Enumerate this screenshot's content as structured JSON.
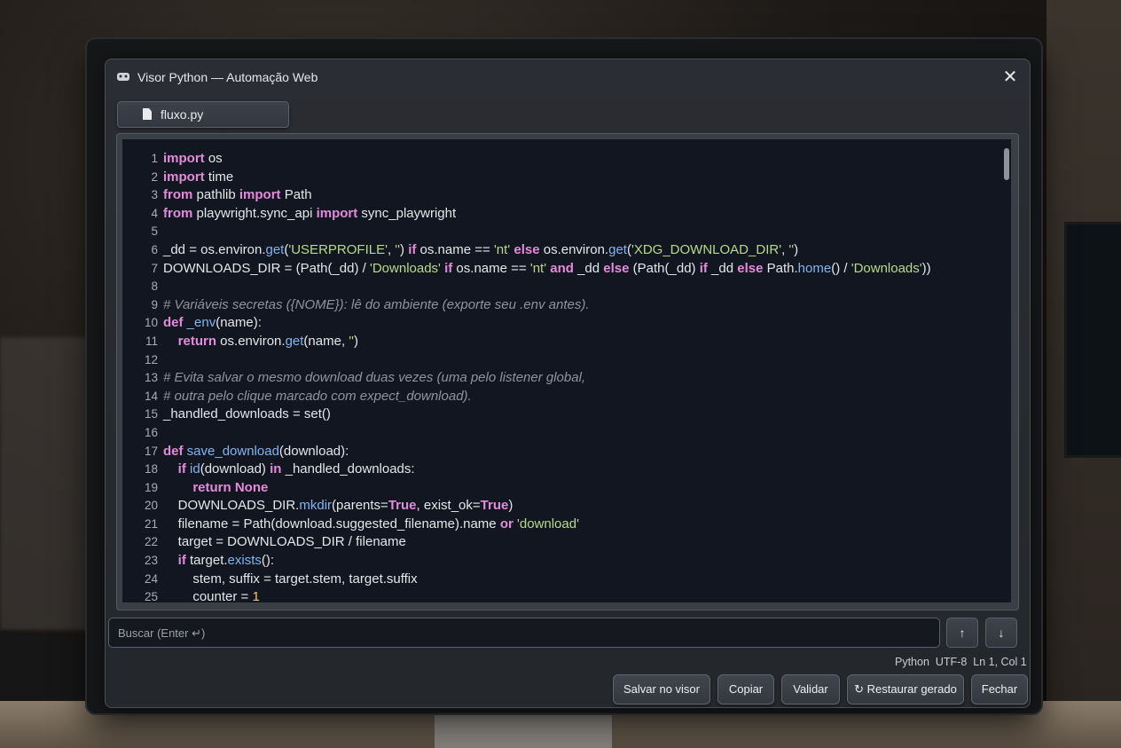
{
  "window": {
    "title": "Visor Python — Automação Web",
    "close_glyph": "✕"
  },
  "tab": {
    "label": "fluxo.py"
  },
  "editor": {
    "lines": [
      {
        "n": "1",
        "html": "<span class=\"kw\">import</span> os"
      },
      {
        "n": "2",
        "html": "<span class=\"kw\">import</span> time"
      },
      {
        "n": "3",
        "html": "<span class=\"kw\">from</span> pathlib <span class=\"kw\">import</span> Path"
      },
      {
        "n": "4",
        "html": "<span class=\"kw\">from</span> playwright.sync_api <span class=\"kw\">import</span> sync_playwright"
      },
      {
        "n": "5",
        "html": ""
      },
      {
        "n": "6",
        "html": "_dd = os.environ.<span class=\"fn\">get</span>(<span class=\"str\">'USERPROFILE'</span>, <span class=\"str\">''</span>) <span class=\"kw\">if</span> os.name == <span class=\"str\">'nt'</span> <span class=\"kw\">else</span> os.environ.<span class=\"fn\">get</span>(<span class=\"str\">'XDG_DOWNLOAD_DIR'</span>, <span class=\"str\">''</span>)"
      },
      {
        "n": "7",
        "html": "DOWNLOADS_DIR = (Path(_dd) / <span class=\"str\">'Downloads'</span> <span class=\"kw\">if</span> os.name == <span class=\"str\">'nt'</span> <span class=\"kw\">and</span> _dd <span class=\"kw\">else</span> (Path(_dd) <span class=\"kw\">if</span> _dd <span class=\"kw\">else</span> Path.<span class=\"fn\">home</span>() / <span class=\"str\">'Downloads'</span>))"
      },
      {
        "n": "8",
        "html": ""
      },
      {
        "n": "9",
        "html": "<span class=\"cm\"># Variáveis secretas ({NOME}): lê do ambiente (exporte seu .env antes).</span>"
      },
      {
        "n": "10",
        "html": "<span class=\"kw\">def</span> <span class=\"fn\">_env</span>(name):"
      },
      {
        "n": "11",
        "html": "    <span class=\"kw\">return</span> os.environ.<span class=\"fn\">get</span>(name, <span class=\"str\">''</span>)"
      },
      {
        "n": "12",
        "html": ""
      },
      {
        "n": "13",
        "html": "<span class=\"cm\"># Evita salvar o mesmo download duas vezes (uma pelo listener global,</span>"
      },
      {
        "n": "14",
        "html": "<span class=\"cm\"># outra pelo clique marcado com expect_download).</span>"
      },
      {
        "n": "15",
        "html": "_handled_downloads = set()"
      },
      {
        "n": "16",
        "html": ""
      },
      {
        "n": "17",
        "html": "<span class=\"kw\">def</span> <span class=\"fn\">save_download</span>(download):"
      },
      {
        "n": "18",
        "html": "    <span class=\"kw\">if</span> <span class=\"fn\">id</span>(download) <span class=\"kw\">in</span> _handled_downloads:"
      },
      {
        "n": "19",
        "html": "        <span class=\"kw\">return None</span>"
      },
      {
        "n": "20",
        "html": "    DOWNLOADS_DIR.<span class=\"fn\">mkdir</span>(parents=<span class=\"kw\">True</span>, exist_ok=<span class=\"kw\">True</span>)"
      },
      {
        "n": "21",
        "html": "    filename = Path(download.suggested_filename).name <span class=\"kw\">or</span> <span class=\"str\">'download'</span>"
      },
      {
        "n": "22",
        "html": "    target = DOWNLOADS_DIR / filename"
      },
      {
        "n": "23",
        "html": "    <span class=\"kw\">if</span> target.<span class=\"fn\">exists</span>():"
      },
      {
        "n": "24",
        "html": "        stem, suffix = target.stem, target.suffix"
      },
      {
        "n": "25",
        "html": "        counter = <span class=\"num\">1</span>"
      }
    ]
  },
  "search": {
    "placeholder": "Buscar (Enter ↵)",
    "prev_glyph": "↑",
    "next_glyph": "↓"
  },
  "status": {
    "language": "Python",
    "encoding": "UTF-8",
    "position": "Ln 1, Col 1"
  },
  "buttons": {
    "save": "Salvar no visor",
    "copy": "Copiar",
    "validate": "Validar",
    "restore": "↻ Restaurar gerado",
    "close": "Fechar"
  }
}
